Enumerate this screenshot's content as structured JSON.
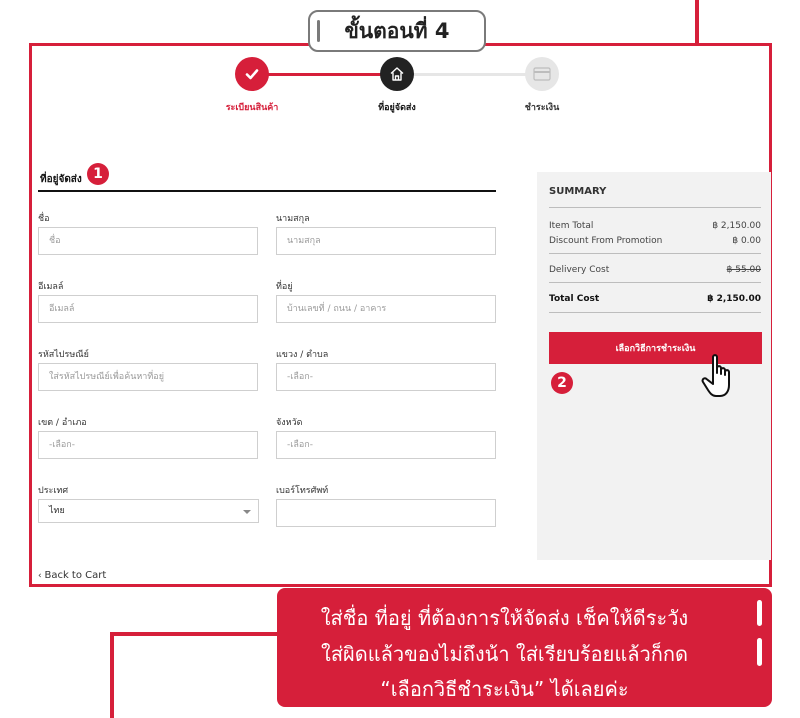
{
  "step_header": {
    "label": "ขั้นตอนที่ 4"
  },
  "stepper": {
    "steps": [
      {
        "label": "ระเบียนสินค้า",
        "state": "done",
        "icon": "check-icon"
      },
      {
        "label": "ที่อยู่จัดส่ง",
        "state": "active",
        "icon": "home-icon"
      },
      {
        "label": "ชำระเงิน",
        "state": "pending",
        "icon": "card-icon"
      }
    ]
  },
  "form": {
    "section_title": "ที่อยู่จัดส่ง",
    "section_badge": "1",
    "fields": {
      "first_name": {
        "label": "ชื่อ",
        "placeholder": "ชื่อ"
      },
      "last_name": {
        "label": "นามสกุล",
        "placeholder": "นามสกุล"
      },
      "email": {
        "label": "อีเมลล์",
        "placeholder": "อีเมลล์"
      },
      "address": {
        "label": "ที่อยู่",
        "placeholder": "บ้านเลขที่ / ถนน / อาคาร"
      },
      "postcode": {
        "label": "รหัสไปรษณีย์",
        "placeholder": "ใส่รหัสไปรษณีย์เพื่อค้นหาที่อยู่"
      },
      "subdistrict": {
        "label": "แขวง / ตำบล",
        "placeholder": "-เลือก-"
      },
      "district": {
        "label": "เขต / อำเภอ",
        "placeholder": "-เลือก-"
      },
      "province": {
        "label": "จังหวัด",
        "placeholder": "-เลือก-"
      },
      "country": {
        "label": "ประเทศ",
        "value": "ไทย"
      },
      "phone": {
        "label": "เบอร์โทรศัพท์",
        "placeholder": ""
      }
    },
    "back_link": "Back to Cart"
  },
  "summary": {
    "title": "SUMMARY",
    "item_total_label": "Item Total",
    "item_total_value": "฿ 2,150.00",
    "discount_label": "Discount From Promotion",
    "discount_value": "฿ 0.00",
    "delivery_label": "Delivery Cost",
    "delivery_value": "฿ 55.00",
    "total_label": "Total Cost",
    "total_value": "฿ 2,150.00",
    "pay_button": "เลือกวิธีการชำระเงิน",
    "pay_badge": "2"
  },
  "callout": {
    "lines": [
      "ใส่ชื่อ ที่อยู่ ที่ต้องการให้จัดส่ง เช็คให้ดีระวัง",
      "ใส่ผิดแล้วของไม่ถึงน้า ใส่เรียบร้อยแล้วก็กด",
      "“เลือกวิธีชำระเงิน” ได้เลยค่ะ"
    ]
  },
  "colors": {
    "accent": "#d61f3a",
    "active_step": "#222222",
    "pending_step": "#e6e6e6"
  }
}
